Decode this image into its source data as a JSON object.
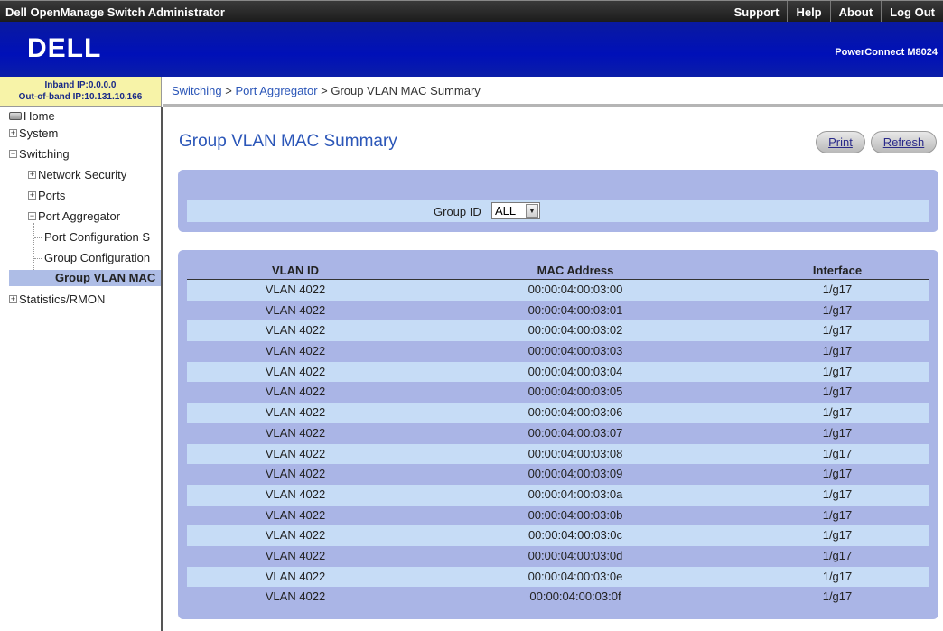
{
  "topbar": {
    "title": "Dell OpenManage Switch Administrator",
    "links": [
      "Support",
      "Help",
      "About",
      "Log Out"
    ]
  },
  "banner": {
    "logo_text": "DELL",
    "product": "PowerConnect M8024"
  },
  "ip_info": {
    "inband": "Inband IP:0.0.0.0",
    "out_of_band": "Out-of-band IP:10.131.10.166"
  },
  "breadcrumb": {
    "items": [
      "Switching",
      "Port Aggregator"
    ],
    "separator": " > ",
    "current": "Group VLAN MAC Summary"
  },
  "sidebar": {
    "home": "Home",
    "system": "System",
    "switching": "Switching",
    "network_security": "Network Security",
    "ports": "Ports",
    "port_aggregator": "Port Aggregator",
    "port_configuration": "Port Configuration S",
    "group_configuration": "Group Configuration",
    "group_vlan_mac": "Group VLAN MAC",
    "statistics": "Statistics/RMON"
  },
  "page": {
    "title": "Group VLAN MAC Summary",
    "print_label": "Print",
    "refresh_label": "Refresh"
  },
  "filter": {
    "label": "Group ID",
    "selected": "ALL"
  },
  "table": {
    "headers": [
      "VLAN ID",
      "MAC Address",
      "Interface"
    ],
    "rows": [
      [
        "VLAN 4022",
        "00:00:04:00:03:00",
        "1/g17"
      ],
      [
        "VLAN 4022",
        "00:00:04:00:03:01",
        "1/g17"
      ],
      [
        "VLAN 4022",
        "00:00:04:00:03:02",
        "1/g17"
      ],
      [
        "VLAN 4022",
        "00:00:04:00:03:03",
        "1/g17"
      ],
      [
        "VLAN 4022",
        "00:00:04:00:03:04",
        "1/g17"
      ],
      [
        "VLAN 4022",
        "00:00:04:00:03:05",
        "1/g17"
      ],
      [
        "VLAN 4022",
        "00:00:04:00:03:06",
        "1/g17"
      ],
      [
        "VLAN 4022",
        "00:00:04:00:03:07",
        "1/g17"
      ],
      [
        "VLAN 4022",
        "00:00:04:00:03:08",
        "1/g17"
      ],
      [
        "VLAN 4022",
        "00:00:04:00:03:09",
        "1/g17"
      ],
      [
        "VLAN 4022",
        "00:00:04:00:03:0a",
        "1/g17"
      ],
      [
        "VLAN 4022",
        "00:00:04:00:03:0b",
        "1/g17"
      ],
      [
        "VLAN 4022",
        "00:00:04:00:03:0c",
        "1/g17"
      ],
      [
        "VLAN 4022",
        "00:00:04:00:03:0d",
        "1/g17"
      ],
      [
        "VLAN 4022",
        "00:00:04:00:03:0e",
        "1/g17"
      ],
      [
        "VLAN 4022",
        "00:00:04:00:03:0f",
        "1/g17"
      ]
    ]
  },
  "colors": {
    "banner_blue": "#0010b8",
    "panel_blue": "#aab5e6",
    "row_light": "#c6dcf6",
    "link_blue": "#2b56b8"
  }
}
